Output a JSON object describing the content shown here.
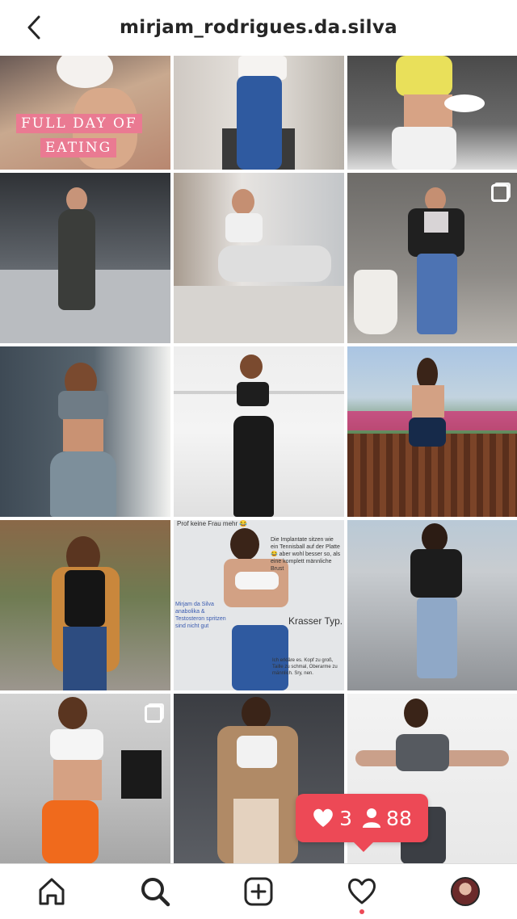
{
  "header": {
    "username": "mirjam_rodrigues.da.silva",
    "back_icon": "chevron-left-icon"
  },
  "posts": [
    {
      "id": "p1",
      "overlay_text": [
        "FULL DAY OF",
        "EATING"
      ]
    },
    {
      "id": "p2"
    },
    {
      "id": "p3"
    },
    {
      "id": "p4"
    },
    {
      "id": "p5"
    },
    {
      "id": "p6",
      "multi": true
    },
    {
      "id": "p7"
    },
    {
      "id": "p8"
    },
    {
      "id": "p9"
    },
    {
      "id": "p10"
    },
    {
      "id": "p11",
      "overlay_text": [
        "Prof keine Frau mehr 😂",
        "Die Implantate sitzen wie ein Tennisball auf der Platte 😂 aber wohl besser so, als eine komplett männliche Brust",
        "Mirjam da Silva anabolika & Testosteron spritzen sind nicht gut",
        "Krasser Typ.",
        "Ich erkläre es. Kopf zu groß, Taille zu schmal, Oberarme zu männlich. Sry, nen."
      ]
    },
    {
      "id": "p12"
    },
    {
      "id": "p13",
      "multi": true
    },
    {
      "id": "p14"
    },
    {
      "id": "p15"
    }
  ],
  "activity_tooltip": {
    "likes": "3",
    "followers": "88",
    "color": "#ed4956"
  },
  "tabbar": {
    "items": [
      "home-icon",
      "search-icon",
      "new-post-icon",
      "activity-heart-icon",
      "profile-avatar"
    ],
    "active": "search-icon"
  }
}
